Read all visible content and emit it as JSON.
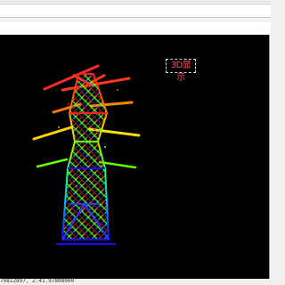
{
  "viewport": {
    "badge_label": "3D显示"
  },
  "status_bar": {
    "coordinate_text": "79812897, Z:41.97808000"
  },
  "colors": {
    "background": "#000000",
    "badge_text": "#ff4b6b",
    "pointcloud_top": "#ff1a1a",
    "pointcloud_mid": "#00ff00",
    "pointcloud_bottom": "#0020ff"
  }
}
